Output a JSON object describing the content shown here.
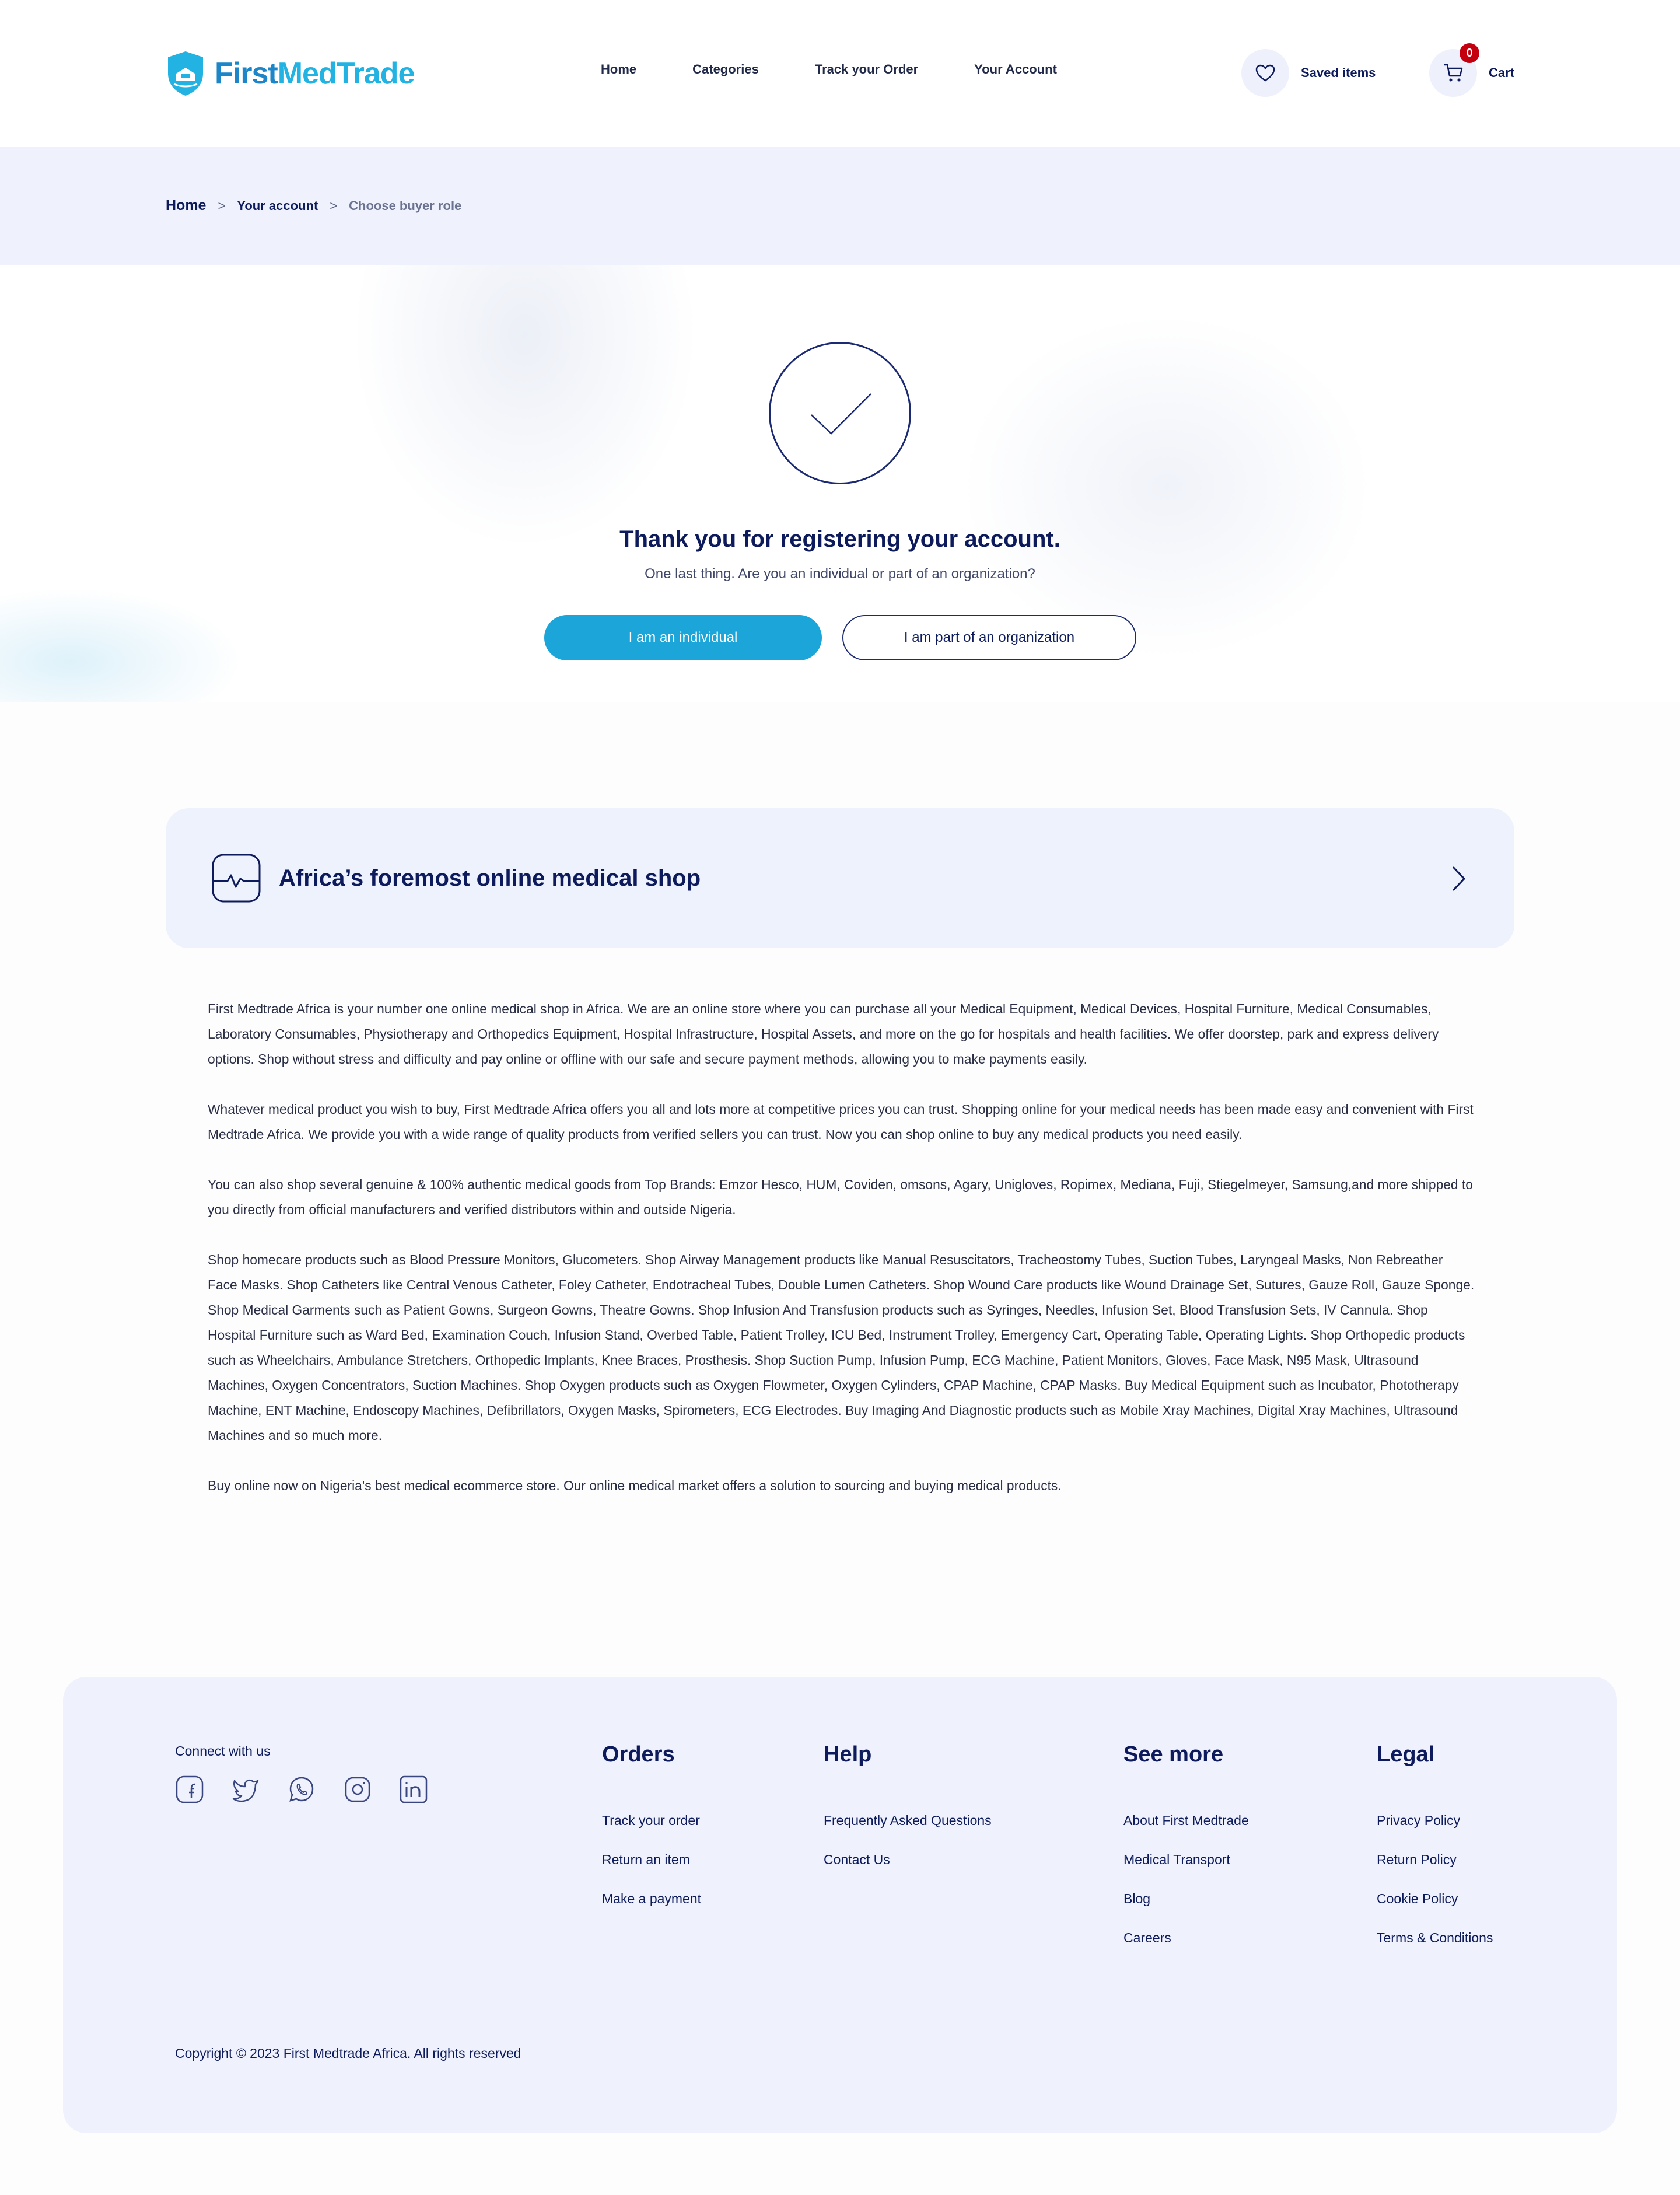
{
  "brand": {
    "part1": "First",
    "part2": "MedTrade"
  },
  "nav": [
    "Home",
    "Categories",
    "Track your Order",
    "Your Account"
  ],
  "header_actions": {
    "saved_label": "Saved items",
    "cart_label": "Cart",
    "cart_count": "0"
  },
  "breadcrumb": {
    "home": "Home",
    "account": "Your account",
    "current": "Choose buyer role",
    "separator": ">"
  },
  "hero": {
    "title": "Thank you for registering your account.",
    "subtitle": "One last thing. Are you an individual or part of an organization?",
    "btn_individual": "I am an individual",
    "btn_organization": "I am part of an organization"
  },
  "info": {
    "title": "Africa’s foremost online medical shop",
    "paragraphs": [
      "First Medtrade Africa is your number one online medical shop in Africa. We are an online store where you can purchase all your Medical Equipment, Medical Devices, Hospital Furniture, Medical Consumables, Laboratory Consumables, Physiotherapy and Orthopedics Equipment, Hospital Infrastructure, Hospital Assets, and more on the go for hospitals and health facilities. We offer doorstep, park and express delivery options. Shop without stress and difficulty and pay online or offline with our safe and secure payment methods, allowing you to make payments easily.",
      "Whatever medical product you wish to buy, First Medtrade Africa offers you all and lots more at competitive prices you can trust. Shopping online for your medical needs has been made easy and convenient with First Medtrade Africa. We provide you with a wide range of quality products from verified sellers you can trust. Now you can shop online to buy any medical products you need easily.",
      "You can also shop several genuine & 100% authentic medical goods from Top Brands: Emzor Hesco, HUM, Coviden, omsons, Agary, Unigloves, Ropimex, Mediana, Fuji, Stiegelmeyer, Samsung,and more shipped to you directly from official manufacturers and verified distributors within and outside Nigeria.",
      "Shop homecare products such as Blood Pressure Monitors, Glucometers. Shop Airway Management products like Manual Resuscitators, Tracheostomy Tubes, Suction Tubes, Laryngeal Masks, Non Rebreather Face Masks. Shop Catheters like Central Venous Catheter, Foley Catheter, Endotracheal Tubes, Double Lumen Catheters. Shop Wound Care products like Wound Drainage Set, Sutures, Gauze Roll, Gauze Sponge. Shop Medical Garments such as Patient Gowns, Surgeon Gowns, Theatre Gowns. Shop Infusion And Transfusion products such as Syringes, Needles, Infusion Set, Blood Transfusion Sets, IV Cannula. Shop Hospital Furniture such as Ward Bed, Examination Couch, Infusion Stand, Overbed Table, Patient Trolley, ICU Bed, Instrument Trolley, Emergency Cart, Operating Table, Operating Lights. Shop Orthopedic products such as Wheelchairs, Ambulance Stretchers, Orthopedic Implants, Knee Braces, Prosthesis. Shop Suction Pump, Infusion Pump, ECG Machine, Patient Monitors, Gloves, Face Mask, N95 Mask, Ultrasound Machines, Oxygen Concentrators, Suction Machines. Shop Oxygen products such as Oxygen Flowmeter, Oxygen Cylinders, CPAP Machine, CPAP Masks. Buy Medical Equipment such as Incubator, Phototherapy Machine, ENT Machine, Endoscopy Machines, Defibrillators, Oxygen Masks, Spirometers, ECG Electrodes. Buy Imaging And Diagnostic products such as Mobile Xray Machines, Digital Xray Machines, Ultrasound Machines and so much more.",
      "Buy online now on Nigeria's best medical ecommerce store. Our online medical market offers a solution to sourcing and buying medical products."
    ]
  },
  "footer": {
    "connect": "Connect with us",
    "socials": [
      "facebook-icon",
      "twitter-icon",
      "whatsapp-icon",
      "instagram-icon",
      "linkedin-icon"
    ],
    "columns": [
      {
        "title": "Orders",
        "links": [
          "Track your order",
          "Return an item",
          "Make a payment"
        ]
      },
      {
        "title": "Help",
        "links": [
          "Frequently Asked Questions",
          "Contact Us"
        ]
      },
      {
        "title": "See more",
        "links": [
          "About First Medtrade",
          "Medical Transport",
          "Blog",
          "Careers"
        ]
      },
      {
        "title": "Legal",
        "links": [
          "Privacy Policy",
          "Return Policy",
          "Cookie Policy",
          "Terms & Conditions"
        ]
      }
    ],
    "copyright": "Copyright © 2023 First Medtrade Africa. All rights reserved"
  },
  "colors": {
    "navy": "#0d1b5c",
    "accent": "#1ba5d8",
    "band": "#eff2fc",
    "badge": "#c4000f"
  }
}
